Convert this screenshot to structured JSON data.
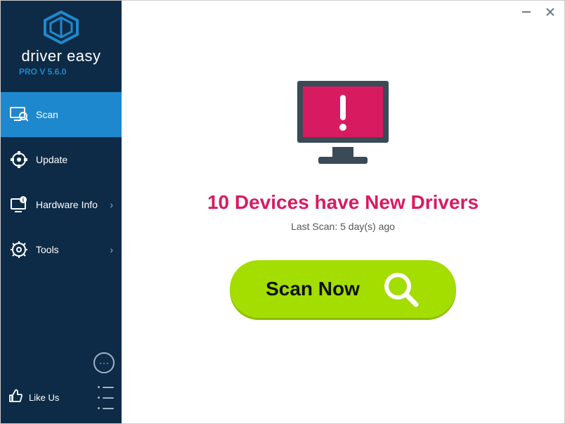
{
  "app": {
    "name": "driver easy",
    "version_label": "PRO V 5.6.0"
  },
  "sidebar": {
    "items": [
      {
        "label": "Scan",
        "icon": "scan-icon",
        "active": true,
        "chevron": false
      },
      {
        "label": "Update",
        "icon": "update-icon",
        "active": false,
        "chevron": false
      },
      {
        "label": "Hardware Info",
        "icon": "hardware-icon",
        "active": false,
        "chevron": true
      },
      {
        "label": "Tools",
        "icon": "tools-icon",
        "active": false,
        "chevron": true
      }
    ],
    "like_label": "Like Us"
  },
  "main": {
    "headline": "10 Devices have New Drivers",
    "last_scan": "Last Scan: 5 day(s) ago",
    "scan_button": "Scan Now"
  },
  "colors": {
    "sidebar_bg": "#0d2b46",
    "active_bg": "#1e88cf",
    "headline": "#d81b60",
    "scan_btn": "#a4dd00"
  }
}
